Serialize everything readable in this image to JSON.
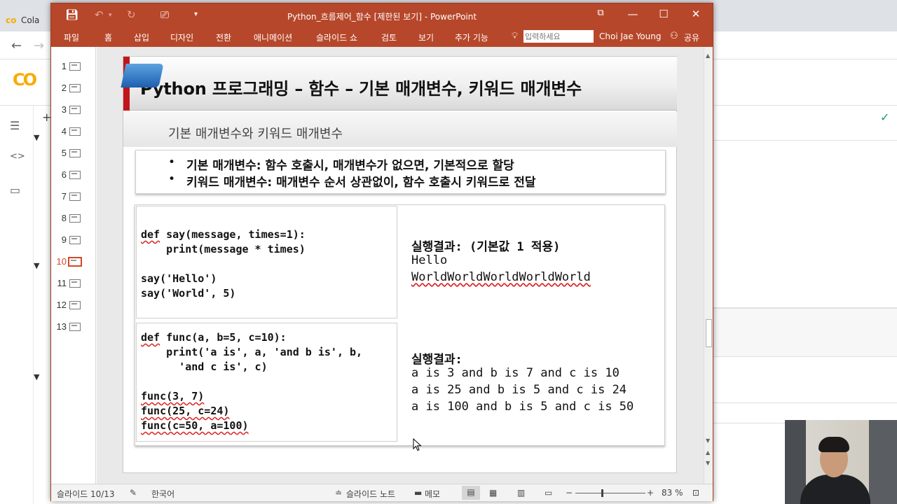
{
  "background_browser": {
    "tab_title": "Cola",
    "check_icon": "check-icon"
  },
  "powerpoint": {
    "title": "Python_흐름제어_함수 [제한된 보기] - PowerPoint",
    "ribbon_tabs": [
      "파일",
      "홈",
      "삽입",
      "디자인",
      "전환",
      "애니메이션",
      "슬라이드 쇼",
      "검토",
      "보기",
      "추가 기능"
    ],
    "tell_me_placeholder": "입력하세요",
    "user_name": "Choi Jae Young",
    "share_label": "공유",
    "thumbnails": [
      "1",
      "2",
      "3",
      "4",
      "5",
      "6",
      "7",
      "8",
      "9",
      "10",
      "11",
      "12",
      "13"
    ],
    "active_slide": "10",
    "status": {
      "slide_info": "슬라이드 10/13",
      "language": "한국어",
      "notes": "슬라이드 노트",
      "comments": "메모",
      "zoom_percent": "83 %"
    },
    "zoom_level": 0.83
  },
  "slide": {
    "title": "Python 프로그래밍 – 함수 – 기본 매개변수, 키워드 매개변수",
    "subtitle": "기본 매개변수와 키워드 매개변수",
    "bullets": [
      "기본 매개변수: 함수 호출시, 매개변수가 없으면, 기본적으로 할당",
      "키워드 매개변수: 매개변수 순서 상관없이, 함수 호출시 키워드로 전달"
    ],
    "code1": [
      "def say(message, times=1):",
      "    print(message * times)",
      "",
      "say('Hello')",
      "say('World', 5)"
    ],
    "result1_title": "실행결과: (기본값 1 적용)",
    "result1": [
      "Hello",
      "WorldWorldWorldWorldWorld"
    ],
    "code2": [
      "def func(a, b=5, c=10):",
      "    print('a is', a, 'and b is', b,",
      "      'and c is', c)",
      "",
      "func(3, 7)",
      "func(25, c=24)",
      "func(c=50, a=100)"
    ],
    "result2_title": "실행결과:",
    "result2": [
      "a is 3 and b is 7 and c is 10",
      "a is 25 and b is 5 and c is 24",
      "a is 100 and b is 5 and c is 50"
    ]
  }
}
